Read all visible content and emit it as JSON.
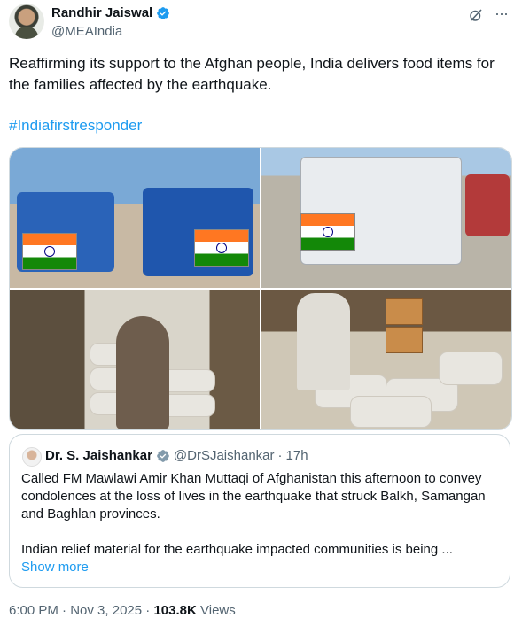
{
  "author": {
    "name": "Randhir Jaiswal",
    "handle": "@MEAIndia",
    "verified_color": "#1d9bf0"
  },
  "header_icons": [
    "grok-icon",
    "more-icon"
  ],
  "tweet": {
    "text": "Reaffirming its support to the Afghan people, India delivers food items for the families affected by the earthquake.",
    "hashtag": "#Indiafirstresponder"
  },
  "media": {
    "count": 4,
    "photos": [
      "photo-trucks-flags",
      "photo-truck-loading",
      "photo-sacks-in-truck",
      "photo-sacks-and-boxes"
    ]
  },
  "quoted_tweet": {
    "name": "Dr. S. Jaishankar",
    "handle": "@DrSJaishankar",
    "separator": "·",
    "time": "17h",
    "text": "Called FM Mawlawi Amir Khan Muttaqi of Afghanistan this afternoon to convey condolences at the loss of lives in the earthquake that struck Balkh, Samangan and Baghlan provinces.",
    "text2": "Indian relief material for the earthquake impacted communities is being ...",
    "show_more": "Show more"
  },
  "meta": {
    "time": "6:00 PM",
    "separator": "·",
    "date": "Nov 3, 2025",
    "separator2": "·",
    "views_count": "103.8K",
    "views_label": "Views"
  },
  "colors": {
    "link": "#1d9bf0",
    "secondary_text": "#536471",
    "primary_text": "#0f1419",
    "border": "#cfd9de"
  }
}
